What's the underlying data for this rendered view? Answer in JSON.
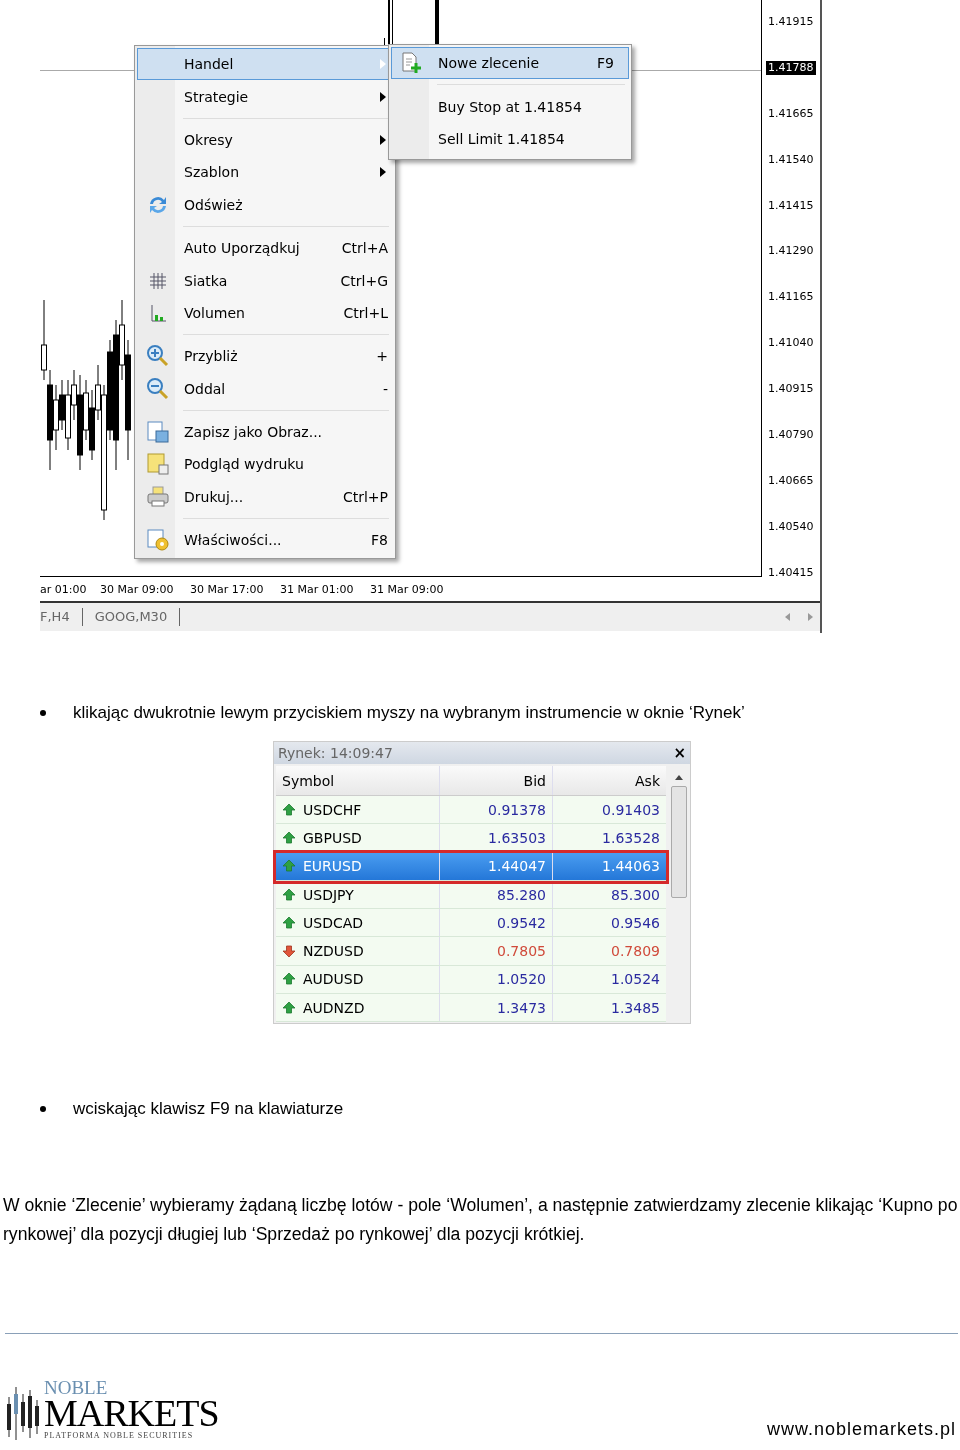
{
  "chart_window": {
    "context_menu": [
      {
        "kind": "item",
        "label": "Handel",
        "submenu": true,
        "selected": true
      },
      {
        "kind": "item",
        "label": "Strategie",
        "submenu": true,
        "selected": false
      },
      {
        "kind": "separator"
      },
      {
        "kind": "item",
        "label": "Okresy",
        "submenu": true,
        "selected": false
      },
      {
        "kind": "item",
        "label": "Szablon",
        "submenu": true,
        "selected": false
      },
      {
        "kind": "item",
        "label": "Odśwież",
        "submenu": false,
        "selected": false
      },
      {
        "kind": "separator"
      },
      {
        "kind": "item",
        "label": "Auto Uporządkuj",
        "shortcut": "Ctrl+A",
        "submenu": false,
        "selected": false
      },
      {
        "kind": "item",
        "label": "Siatka",
        "shortcut": "Ctrl+G",
        "submenu": false,
        "selected": false
      },
      {
        "kind": "item",
        "label": "Volumen",
        "shortcut": "Ctrl+L",
        "submenu": false,
        "selected": false
      },
      {
        "kind": "separator"
      },
      {
        "kind": "item",
        "label": "Przybliż",
        "shortcut": "+",
        "submenu": false,
        "selected": false
      },
      {
        "kind": "item",
        "label": "Oddal",
        "shortcut": "-",
        "submenu": false,
        "selected": false
      },
      {
        "kind": "separator"
      },
      {
        "kind": "item",
        "label": "Zapisz jako Obraz...",
        "submenu": false,
        "selected": false
      },
      {
        "kind": "item",
        "label": "Podgląd wydruku",
        "submenu": false,
        "selected": false
      },
      {
        "kind": "item",
        "label": "Drukuj...",
        "shortcut": "Ctrl+P",
        "submenu": false,
        "selected": false
      },
      {
        "kind": "separator"
      },
      {
        "kind": "item",
        "label": "Właściwości...",
        "shortcut": "F8",
        "submenu": false,
        "selected": false
      }
    ],
    "submenu": [
      {
        "kind": "item",
        "label": "Nowe zlecenie",
        "shortcut": "F9",
        "selected": true
      },
      {
        "kind": "separator"
      },
      {
        "kind": "item",
        "label": "Buy Stop at 1.41854",
        "selected": false
      },
      {
        "kind": "item",
        "label": "Sell Limit 1.41854",
        "selected": false
      }
    ],
    "price_axis": [
      {
        "label": "1.41915",
        "current": false
      },
      {
        "label": "1.41788",
        "current": true
      },
      {
        "label": "1.41665",
        "current": false
      },
      {
        "label": "1.41540",
        "current": false
      },
      {
        "label": "1.41415",
        "current": false
      },
      {
        "label": "1.41290",
        "current": false
      },
      {
        "label": "1.41165",
        "current": false
      },
      {
        "label": "1.41040",
        "current": false
      },
      {
        "label": "1.40915",
        "current": false
      },
      {
        "label": "1.40790",
        "current": false
      },
      {
        "label": "1.40665",
        "current": false
      },
      {
        "label": "1.40540",
        "current": false
      },
      {
        "label": "1.40415",
        "current": false
      }
    ],
    "time_axis": [
      "ar 01:00",
      "30 Mar 09:00",
      "30 Mar 17:00",
      "31 Mar 01:00",
      "31 Mar 09:00"
    ],
    "tabs": [
      "F,H4",
      "GOOG,M30"
    ]
  },
  "bullet_1": "klikając dwukrotnie lewym przyciskiem myszy na wybranym instrumencie w oknie ‘Rynek’",
  "market_watch": {
    "title": "Rynek: 14:09:47",
    "close": "×",
    "columns": [
      "Symbol",
      "Bid",
      "Ask"
    ],
    "rows": [
      {
        "symbol": "USDCHF",
        "bid": "0.91378",
        "ask": "0.91403",
        "rising": true,
        "selected": false
      },
      {
        "symbol": "GBPUSD",
        "bid": "1.63503",
        "ask": "1.63528",
        "rising": true,
        "selected": false
      },
      {
        "symbol": "EURUSD",
        "bid": "1.44047",
        "ask": "1.44063",
        "rising": true,
        "selected": true
      },
      {
        "symbol": "USDJPY",
        "bid": "85.280",
        "ask": "85.300",
        "rising": true,
        "selected": false
      },
      {
        "symbol": "USDCAD",
        "bid": "0.9542",
        "ask": "0.9546",
        "rising": true,
        "selected": false
      },
      {
        "symbol": "NZDUSD",
        "bid": "0.7805",
        "ask": "0.7809",
        "rising": false,
        "selected": false
      },
      {
        "symbol": "AUDUSD",
        "bid": "1.0520",
        "ask": "1.0524",
        "rising": true,
        "selected": false
      },
      {
        "symbol": "AUDNZD",
        "bid": "1.3473",
        "ask": "1.3485",
        "rising": true,
        "selected": false
      }
    ]
  },
  "bullet_2": "wciskając klawisz F9 na klawiaturze",
  "paragraph": "W oknie ‘Zlecenie’ wybieramy żądaną liczbę lotów - pole ‘Wolumen’, a następnie zatwierdzamy zlecenie klikając ‘Kupno po rynkowej’ dla pozycji długiej lub ‘Sprzedaż po rynkowej’ dla pozycji krótkiej.",
  "footer": {
    "logo_top": "NOBLE",
    "logo_main": "MARKETS",
    "logo_sub": "PLATFORMA NOBLE SECURITIES",
    "url": "www.noblemarkets.pl"
  }
}
